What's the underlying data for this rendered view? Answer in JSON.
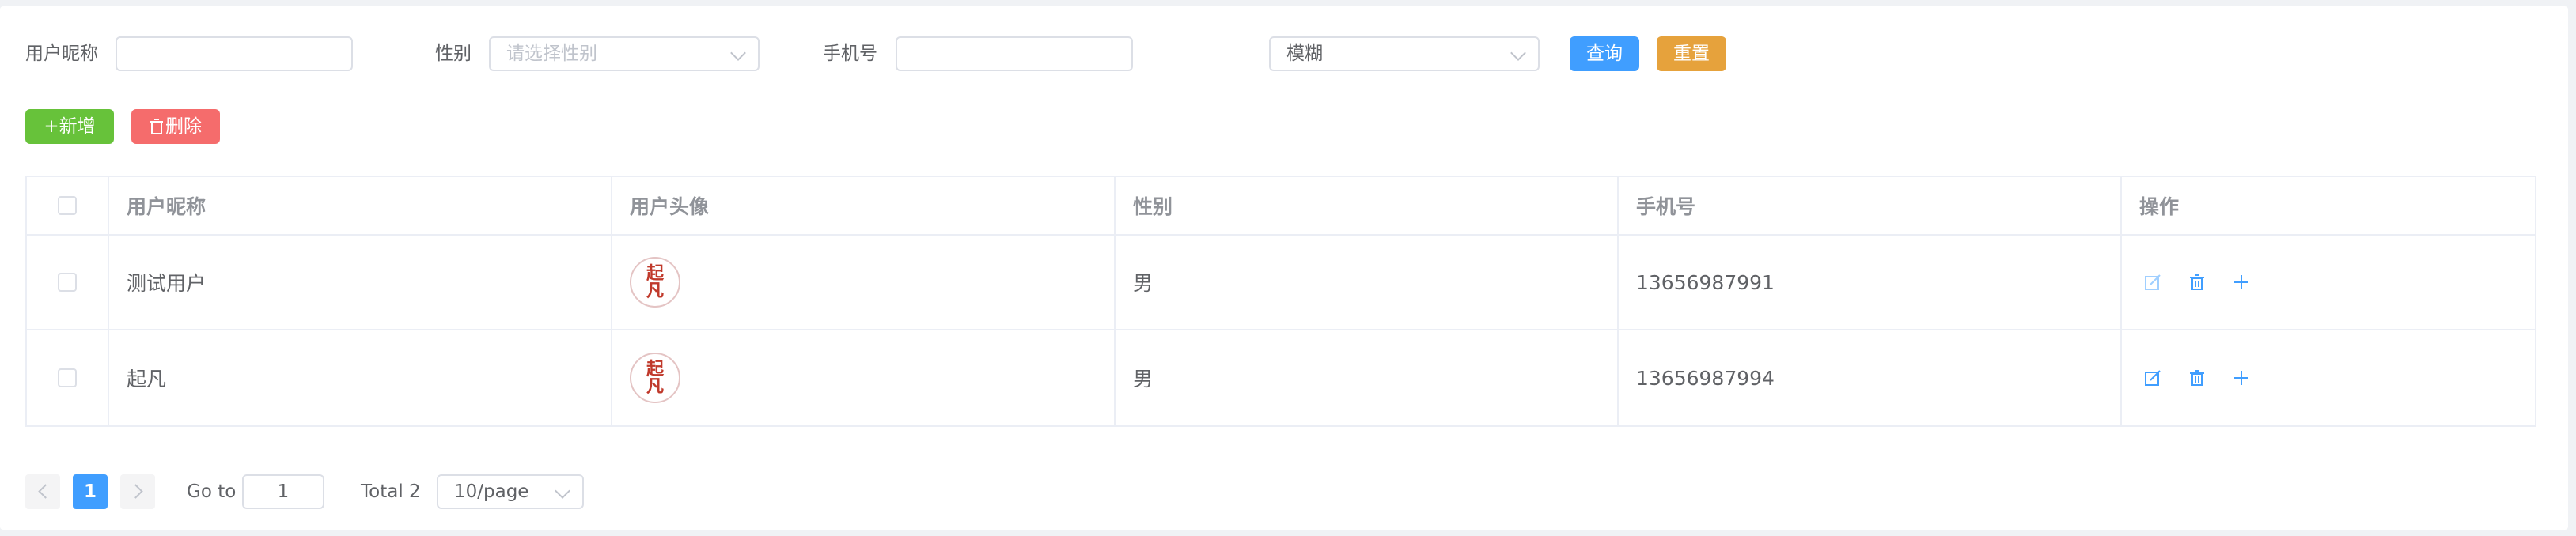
{
  "search": {
    "nickname_label": "用户昵称",
    "nickname_value": "",
    "gender_label": "性别",
    "gender_placeholder": "请选择性别",
    "phone_label": "手机号",
    "phone_value": "",
    "match_mode": "模糊",
    "query_button": "查询",
    "reset_button": "重置"
  },
  "toolbar": {
    "add_button": "+新增",
    "delete_button": "删除"
  },
  "table": {
    "columns": [
      "用户昵称",
      "用户头像",
      "性别",
      "手机号",
      "操作"
    ],
    "rows": [
      {
        "nickname": "测试用户",
        "avatar_text": "起凡",
        "gender": "男",
        "phone": "13656987991"
      },
      {
        "nickname": "起凡",
        "avatar_text": "起凡",
        "gender": "男",
        "phone": "13656987994"
      }
    ]
  },
  "pagination": {
    "current_page": "1",
    "goto_label": "Go to",
    "goto_value": "1",
    "total_text": "Total 2",
    "page_size": "10/page"
  },
  "colors": {
    "primary": "#409eff",
    "warning": "#e6a23c",
    "success": "#67c23a",
    "danger": "#f56c6c"
  },
  "icons": [
    "chevron-down-icon",
    "plus-icon",
    "trash-icon",
    "edit-icon",
    "chevron-left-icon",
    "chevron-right-icon"
  ]
}
